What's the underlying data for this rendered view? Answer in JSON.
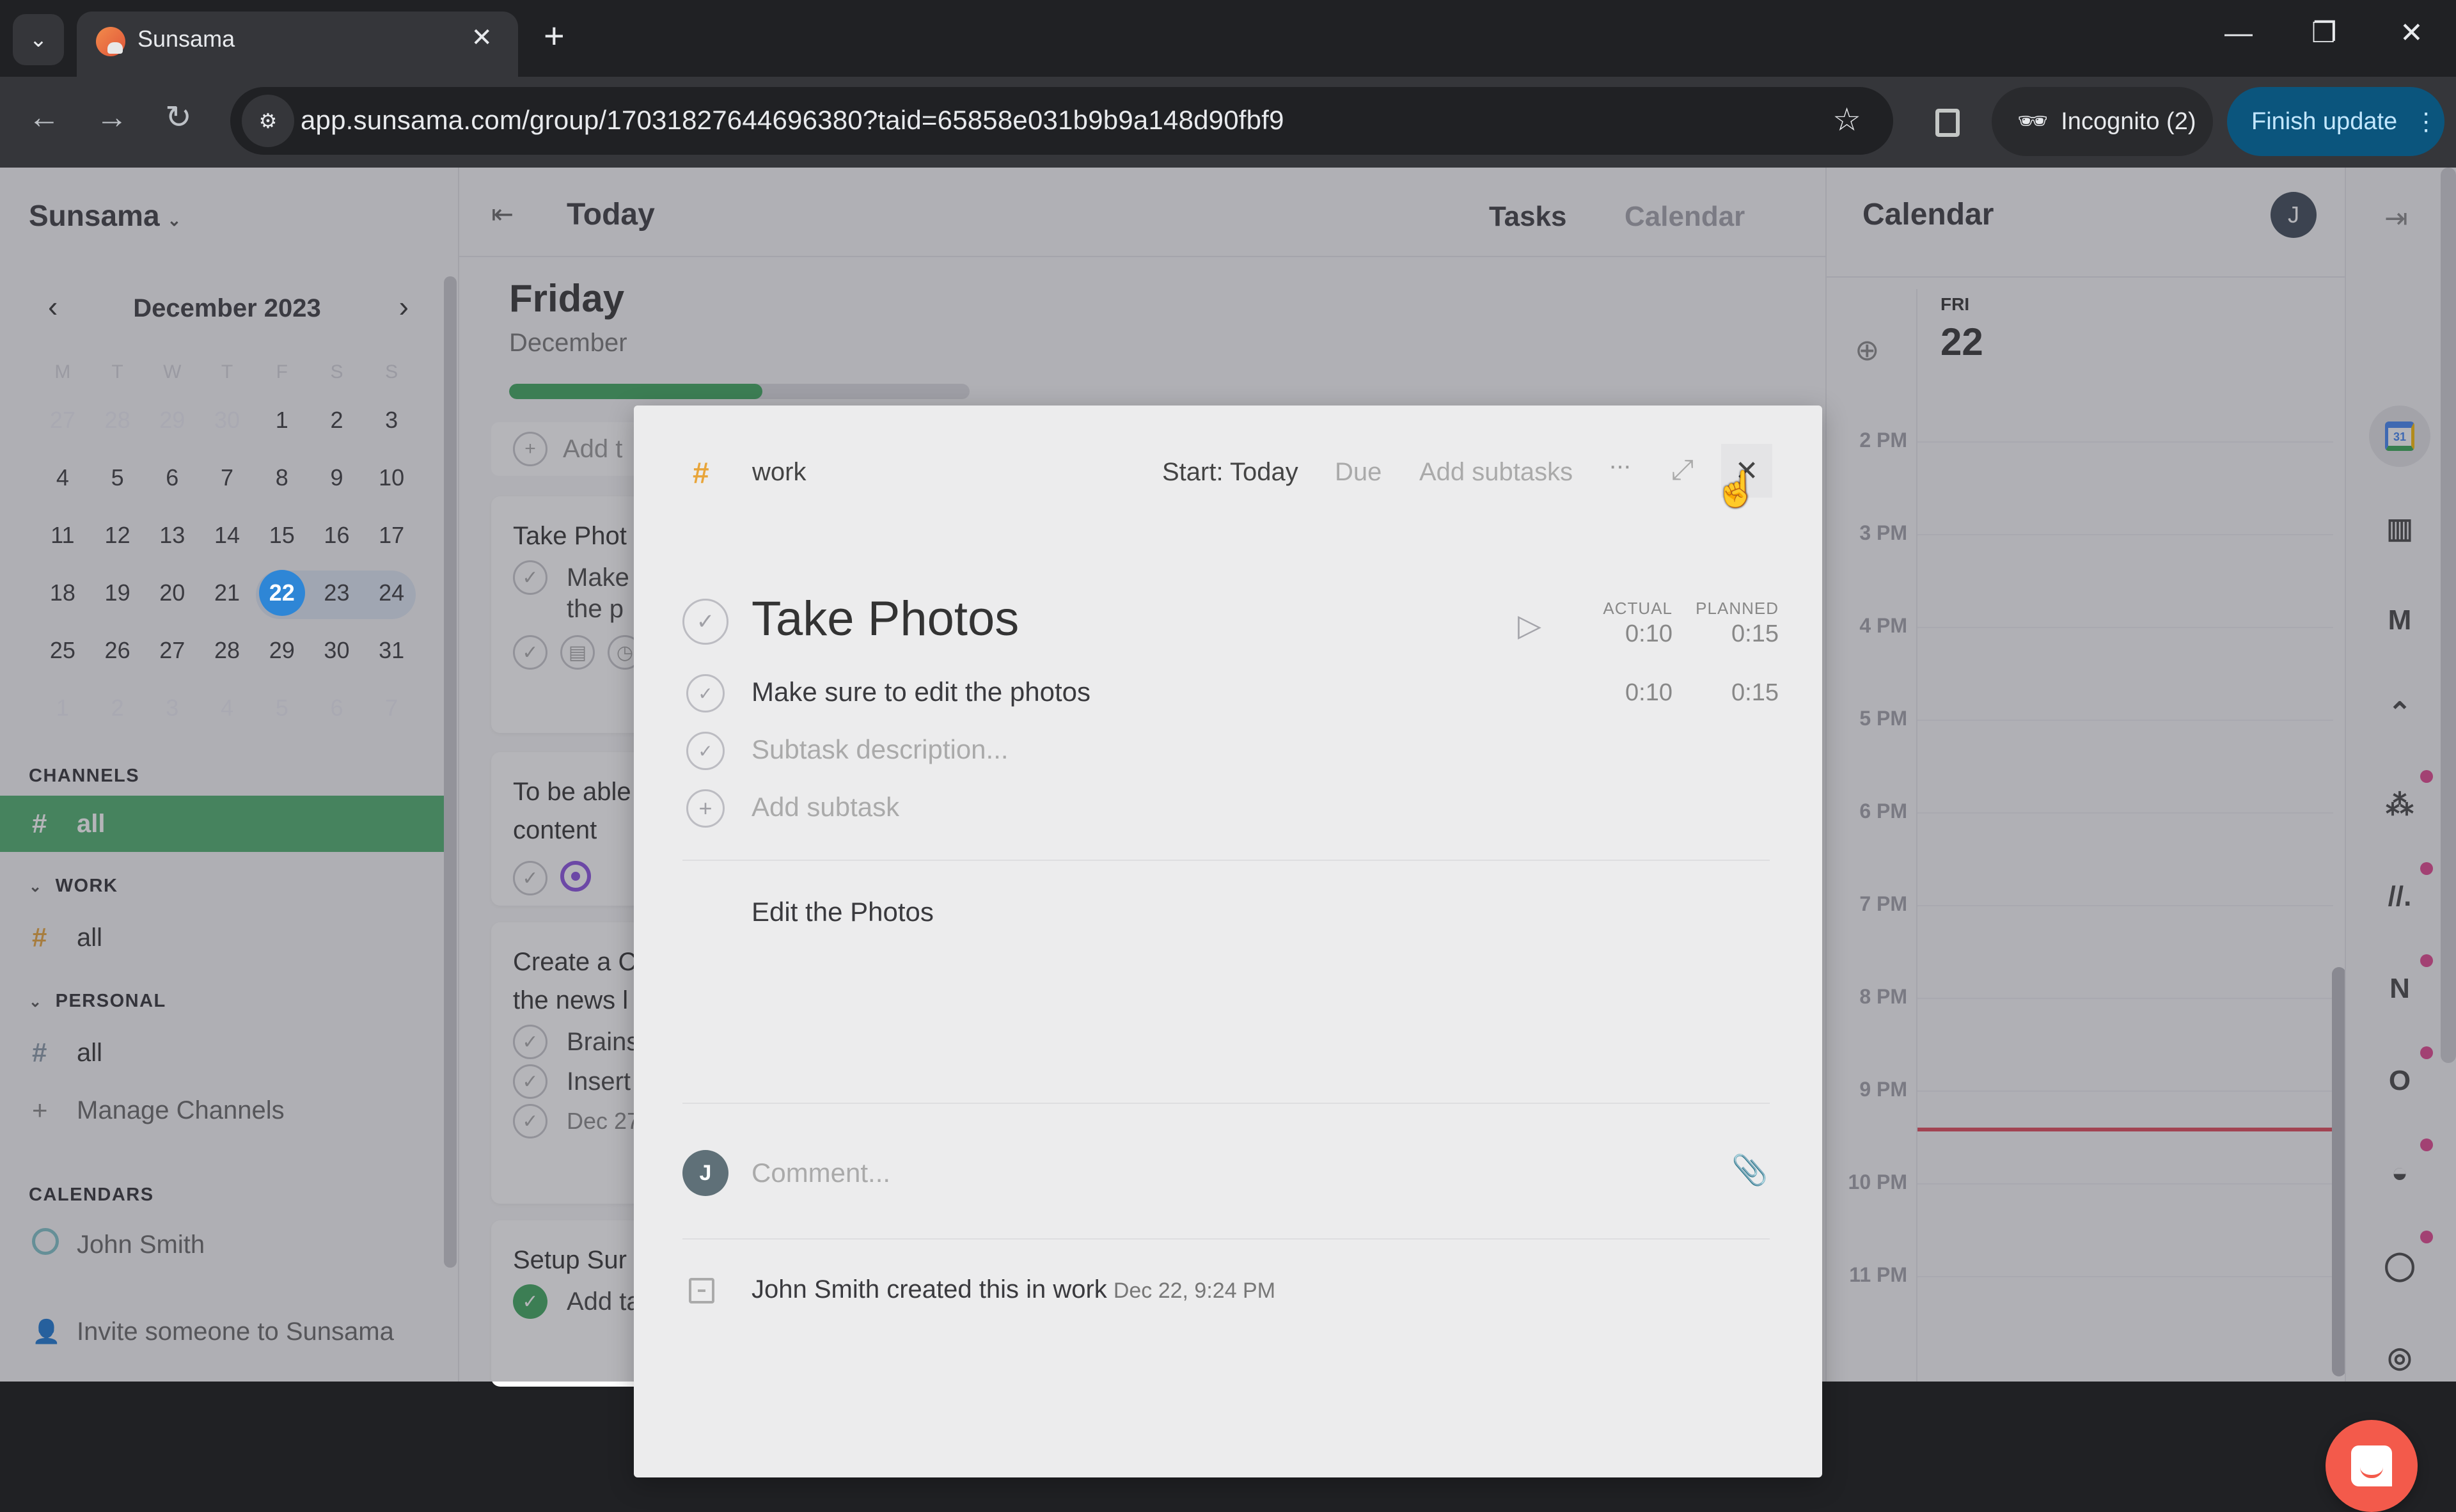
{
  "browser": {
    "tab_title": "Sunsama",
    "url": "app.sunsama.com/group/17031827644696380?taid=65858e031b9b9a148d90fbf9",
    "incognito_label": "Incognito (2)",
    "update_label": "Finish update"
  },
  "sidebar": {
    "workspace": "Sunsama",
    "mini_calendar": {
      "month_label": "December 2023",
      "weekdays": [
        "M",
        "T",
        "W",
        "T",
        "F",
        "S",
        "S"
      ],
      "weeks": [
        [
          "27",
          "28",
          "29",
          "30",
          "1",
          "2",
          "3"
        ],
        [
          "4",
          "5",
          "6",
          "7",
          "8",
          "9",
          "10"
        ],
        [
          "11",
          "12",
          "13",
          "14",
          "15",
          "16",
          "17"
        ],
        [
          "18",
          "19",
          "20",
          "21",
          "22",
          "23",
          "24"
        ],
        [
          "25",
          "26",
          "27",
          "28",
          "29",
          "30",
          "31"
        ],
        [
          "1",
          "2",
          "3",
          "4",
          "5",
          "6",
          "7"
        ]
      ],
      "selected": "22"
    },
    "channels_title": "CHANNELS",
    "channels": [
      {
        "label": "all",
        "active": true
      }
    ],
    "groups": [
      {
        "title": "WORK",
        "items": [
          {
            "label": "all",
            "hash_color": "#e8a53a"
          }
        ]
      },
      {
        "title": "PERSONAL",
        "items": [
          {
            "label": "all",
            "hash_color": "#8a9aa8"
          }
        ]
      }
    ],
    "manage_channels": "Manage Channels",
    "calendars_title": "CALENDARS",
    "calendars": [
      {
        "label": "John Smith"
      }
    ],
    "invite": "Invite someone to Sunsama"
  },
  "main": {
    "header_title": "Today",
    "tabs": [
      {
        "label": "Tasks",
        "active": true
      },
      {
        "label": "Calendar",
        "active": false
      }
    ],
    "day": {
      "name": "Friday",
      "date": "December",
      "progress": 0.55,
      "add_task": "Add t"
    },
    "tasks": [
      {
        "title": "Take Phot",
        "subtasks": [
          "Make",
          "the p"
        ]
      },
      {
        "title": "To be able",
        "title_line2": "content"
      },
      {
        "title": "Create a C",
        "title_line2": "the news l",
        "subtasks": [
          "Brains",
          "Insert"
        ],
        "date": "Dec 27"
      },
      {
        "title": "Setup Sur",
        "subtasks": [
          "Add tasks"
        ]
      }
    ]
  },
  "calendar_panel": {
    "title": "Calendar",
    "avatar_initial": "J",
    "day_name": "FRI",
    "day_number": "22",
    "hours": [
      "2 PM",
      "3 PM",
      "4 PM",
      "5 PM",
      "6 PM",
      "7 PM",
      "8 PM",
      "9 PM",
      "10 PM",
      "11 PM"
    ],
    "now_time": "9:24 PM"
  },
  "rail": {
    "items": [
      {
        "name": "google-calendar",
        "badge": false
      },
      {
        "name": "trello",
        "badge": false
      },
      {
        "name": "gmail",
        "badge": false
      },
      {
        "name": "clickup",
        "badge": false
      },
      {
        "name": "asana",
        "badge": true
      },
      {
        "name": "monday",
        "badge": true
      },
      {
        "name": "notion",
        "badge": true
      },
      {
        "name": "outlook",
        "badge": true
      },
      {
        "name": "linear",
        "badge": true
      },
      {
        "name": "github",
        "badge": true
      },
      {
        "name": "goals",
        "badge": false
      },
      {
        "name": "archive",
        "badge": false
      }
    ]
  },
  "modal": {
    "channel": "work",
    "start_label": "Start: Today",
    "due_label": "Due",
    "add_subtasks_label": "Add subtasks",
    "more_label": "···",
    "title": "Take Photos",
    "actual_label": "ACTUAL",
    "planned_label": "PLANNED",
    "actual_total": "0:10",
    "planned_total": "0:15",
    "subtasks": [
      {
        "text": "Make sure to edit the photos",
        "actual": "0:10",
        "planned": "0:15"
      }
    ],
    "subtask_placeholder": "Subtask description...",
    "add_subtask": "Add subtask",
    "notes": "Edit the Photos",
    "comment_avatar": "J",
    "comment_placeholder": "Comment...",
    "activity_text": "John Smith created this in work",
    "activity_time": "Dec 22, 9:24 PM"
  }
}
